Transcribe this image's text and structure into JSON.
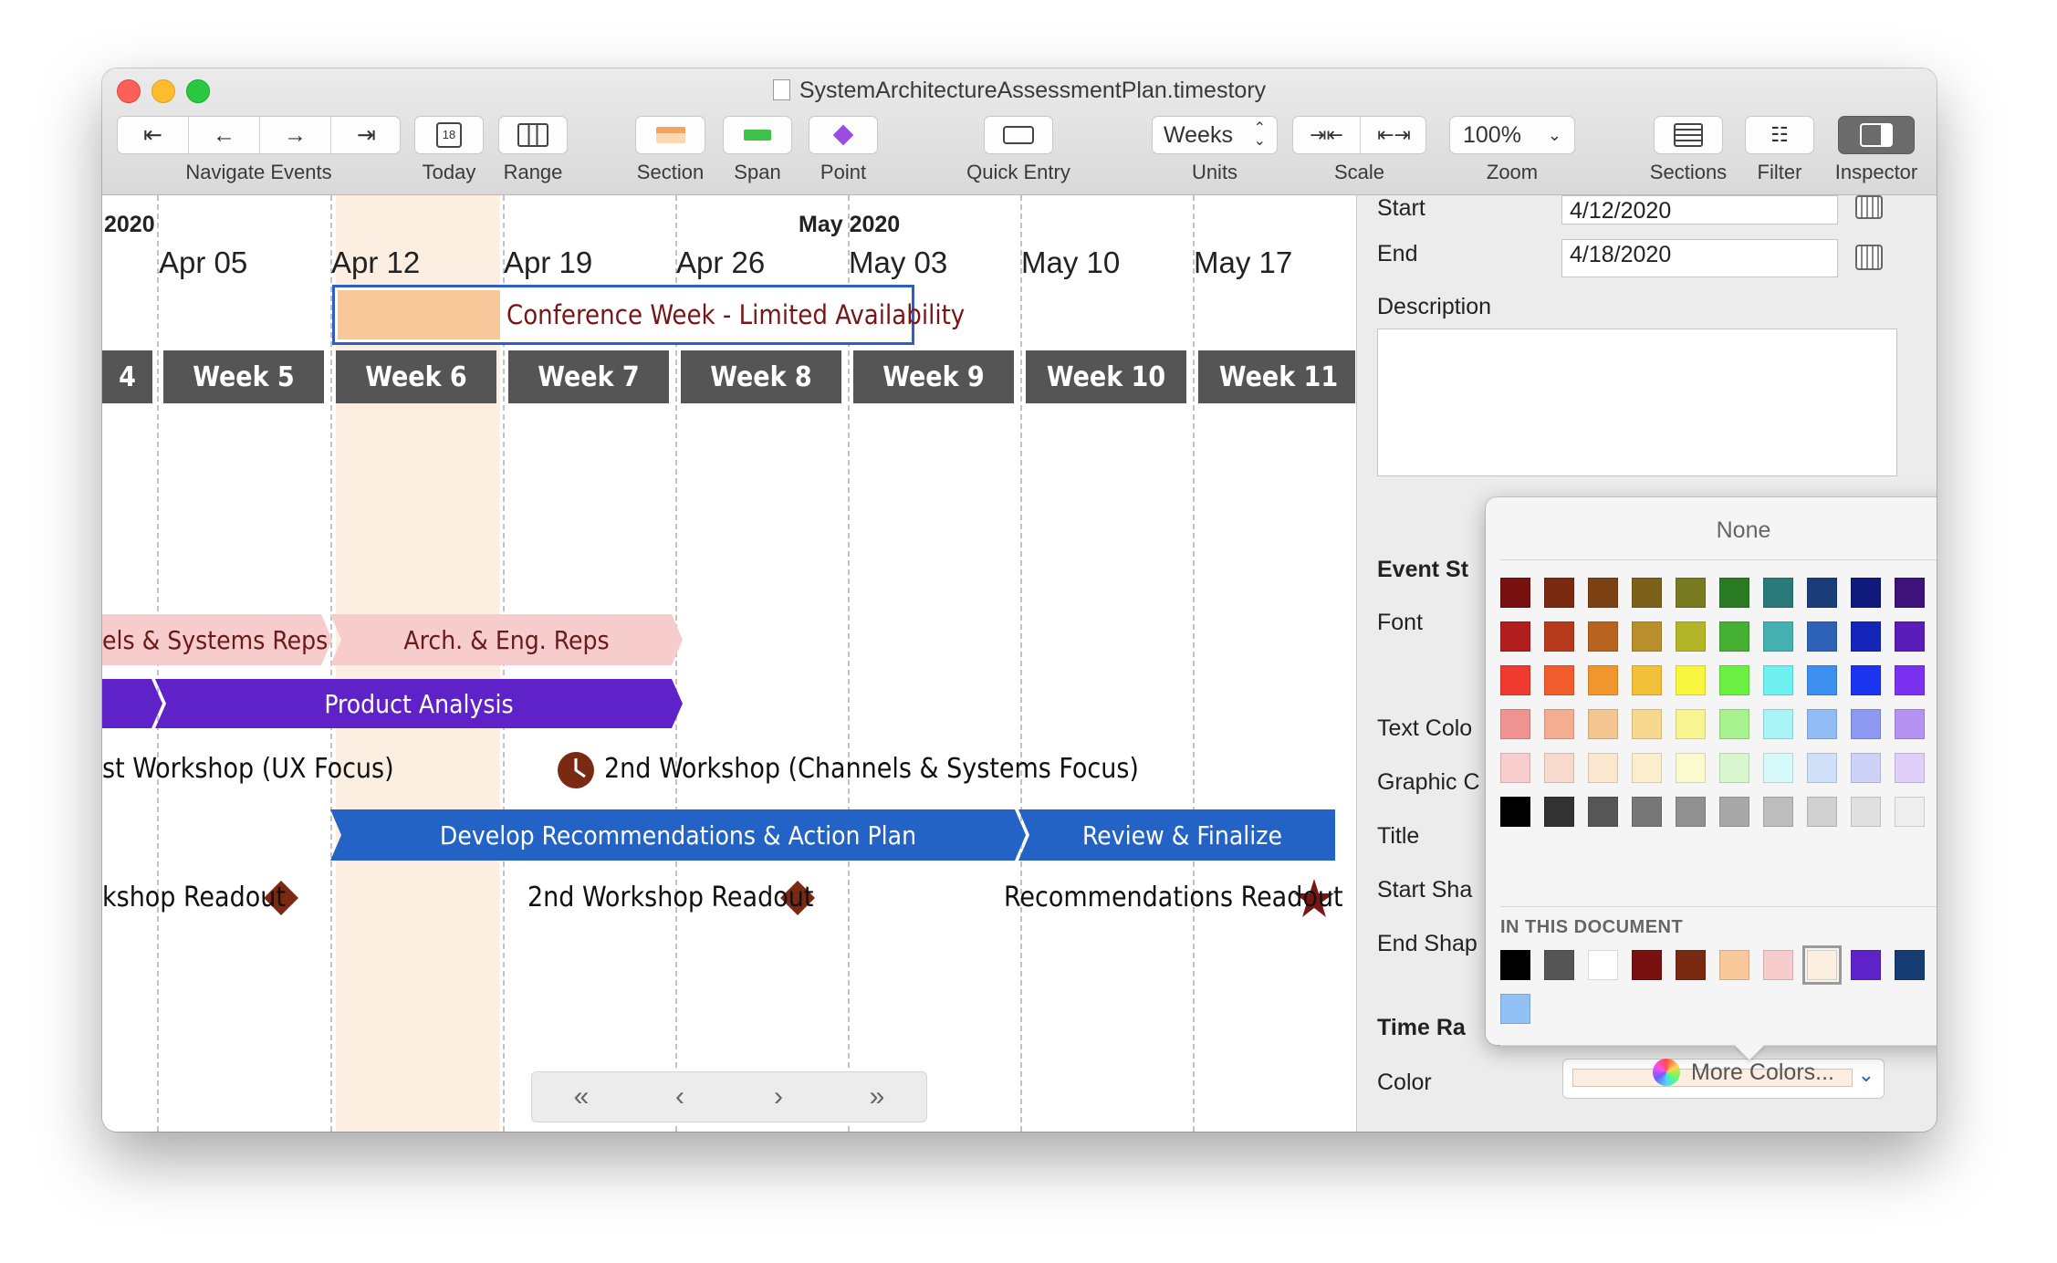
{
  "window": {
    "title": "SystemArchitectureAssessmentPlan.timestory"
  },
  "toolbar": {
    "navigate_label": "Navigate Events",
    "today_label": "Today",
    "today_icon_text": "18",
    "range_label": "Range",
    "section_label": "Section",
    "span_label": "Span",
    "point_label": "Point",
    "quick_entry_label": "Quick Entry",
    "units_label": "Units",
    "units_value": "Weeks",
    "scale_label": "Scale",
    "zoom_label": "Zoom",
    "zoom_value": "100%",
    "sections_label": "Sections",
    "filter_label": "Filter",
    "inspector_label": "Inspector"
  },
  "timeline": {
    "years": [
      "2020",
      "May 2020"
    ],
    "dates": [
      "Apr 05",
      "Apr 12",
      "Apr 19",
      "Apr 26",
      "May 03",
      "May 10",
      "May 17"
    ],
    "weeks": [
      "4",
      "Week 5",
      "Week 6",
      "Week 7",
      "Week 8",
      "Week 9",
      "Week 10",
      "Week 11"
    ],
    "conference": "Conference Week - Limited Availability",
    "events": {
      "els_systems_reps": "els & Systems Reps",
      "arch_eng_reps": "Arch. & Eng. Reps",
      "product_analysis": "Product Analysis",
      "workshop1": "st Workshop (UX Focus)",
      "workshop2": "2nd Workshop (Channels & Systems Focus)",
      "develop": "Develop Recommendations & Action Plan",
      "review": "Review & Finalize",
      "readout1": "kshop Readout",
      "readout2": "2nd Workshop Readout",
      "readout3": "Recommendations Readout"
    },
    "colors": {
      "highlight_column": "#fdeee2",
      "conference_fill": "#f8c89a",
      "conference_text": "#7a1515",
      "conference_border": "#2f5fc4",
      "week_bar": "#555555",
      "pink_bar": "#f6cccc",
      "purple_bar": "#5e22c8",
      "blue_bar": "#2463c6",
      "marker": "#7a2a12"
    }
  },
  "inspector": {
    "start_label": "Start",
    "start_value": "4/12/2020",
    "end_label": "End",
    "end_value": "4/18/2020",
    "description_label": "Description",
    "event_style_label": "Event St",
    "font_label": "Font",
    "text_color_label": "Text Colo",
    "graphic_label": "Graphic C",
    "title_label": "Title",
    "start_shape_label": "Start Sha",
    "end_shape_label": "End Shap",
    "time_range_label": "Time Ra",
    "color_label": "Color",
    "color_value": "#fdeee2"
  },
  "color_popup": {
    "none_label": "None",
    "in_document_label": "IN THIS DOCUMENT",
    "more_colors_label": "More Colors...",
    "palette": [
      [
        "#7a1111",
        "#7a2a10",
        "#7b4113",
        "#7b6119",
        "#787a1f",
        "#2a7a23",
        "#2b7a7a",
        "#1a3d7a",
        "#0f1a7a",
        "#3d127a",
        "#7a1d7a"
      ],
      [
        "#b01e1e",
        "#b83a1d",
        "#b8621f",
        "#b98f2b",
        "#b3b528",
        "#45b032",
        "#44b1b0",
        "#2e62b8",
        "#1426b9",
        "#5b1db8",
        "#b028b3"
      ],
      [
        "#ef3a32",
        "#f25b2c",
        "#f1952d",
        "#f3c03a",
        "#f7f53d",
        "#6bef42",
        "#6ff0f1",
        "#3d8ff0",
        "#1a34f0",
        "#7a31f0",
        "#ee3bf2"
      ],
      [
        "#ef9290",
        "#f3ad90",
        "#f5c591",
        "#f6d88e",
        "#f7f592",
        "#a8f18f",
        "#a9f4f4",
        "#92bcf3",
        "#8d98f2",
        "#b593f3",
        "#f197f2"
      ],
      [
        "#f7cdcd",
        "#f8d9cd",
        "#fbe7cf",
        "#fbeecd",
        "#fcfbd0",
        "#d8f7cf",
        "#d6fafa",
        "#cfe0f8",
        "#ccd2f8",
        "#e0cff9",
        "#f6cff8"
      ],
      [
        "#000000",
        "#333333",
        "#565656",
        "#777777",
        "#909090",
        "#a8a8a8",
        "#bdbdbd",
        "#d0d0d0",
        "#e0e0e0",
        "#eeeeee",
        "#ffffff"
      ]
    ],
    "document_colors": [
      "#000000",
      "#555555",
      "#ffffff",
      "#7a1111",
      "#7a2a10",
      "#f8c89a",
      "#f6cccc",
      "#fdeee2",
      "#5e22c8",
      "#163c74",
      "#2463c6",
      "#92c1f5"
    ],
    "selected_document_index": 7
  }
}
